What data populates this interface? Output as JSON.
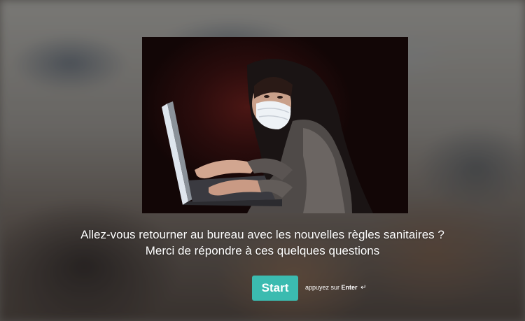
{
  "intro": {
    "question_line1": "Allez-vous retourner au bureau avec les nouvelles règles sanitaires ?",
    "question_line2": "Merci de répondre à ces quelques questions",
    "start_label": "Start",
    "hint_prefix": "appuyez sur",
    "hint_key": "Enter",
    "hint_icon": "↵"
  },
  "colors": {
    "button": "#3bbbb0",
    "text": "#ffffff"
  },
  "icons": {
    "enter": "enter-return-icon"
  }
}
